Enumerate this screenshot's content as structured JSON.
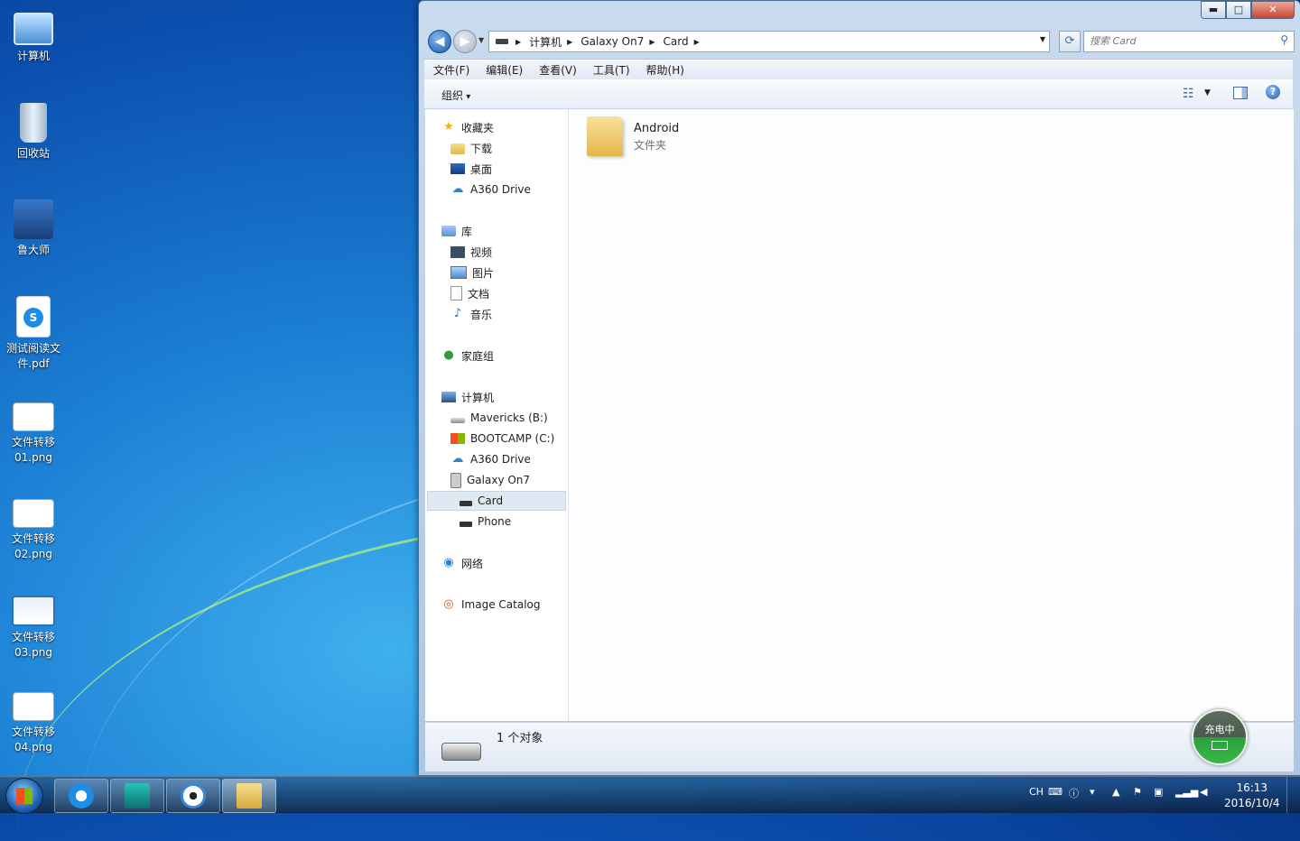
{
  "desktop": {
    "icons": [
      {
        "label": "计算机"
      },
      {
        "label": "回收站"
      },
      {
        "label": "鲁大师"
      },
      {
        "label": "测试阅读文件.pdf"
      },
      {
        "label": "文件转移01.png"
      },
      {
        "label": "文件转移02.png"
      },
      {
        "label": "文件转移03.png"
      },
      {
        "label": "文件转移04.png"
      }
    ]
  },
  "window": {
    "caption": {
      "minimize": "▬",
      "maximize": "□",
      "close": "✕"
    },
    "address": {
      "crumbs": [
        "计算机",
        "Galaxy On7",
        "Card"
      ]
    },
    "search": {
      "placeholder": "搜索 Card"
    },
    "menu": [
      "文件(F)",
      "编辑(E)",
      "查看(V)",
      "工具(T)",
      "帮助(H)"
    ],
    "toolbar": {
      "organize": "组织",
      "help": "?"
    },
    "nav": {
      "favorites": {
        "label": "收藏夹",
        "items": [
          "下载",
          "桌面",
          "A360 Drive"
        ]
      },
      "libraries": {
        "label": "库",
        "items": [
          "视频",
          "图片",
          "文档",
          "音乐"
        ]
      },
      "homegroup": {
        "label": "家庭组"
      },
      "computer": {
        "label": "计算机",
        "items": [
          "Mavericks (B:)",
          "BOOTCAMP (C:)",
          "A360 Drive",
          "Galaxy On7"
        ],
        "device_items": [
          "Card",
          "Phone"
        ]
      },
      "network": {
        "label": "网络"
      },
      "image_catalog": {
        "label": "Image Catalog"
      }
    },
    "content": {
      "items": [
        {
          "name": "Android",
          "type": "文件夹"
        }
      ]
    },
    "details": {
      "count": "1 个对象"
    }
  },
  "charging": {
    "label": "充电中"
  },
  "taskbar": {
    "tray": {
      "lang": "CH"
    },
    "clock": {
      "time": "16:13",
      "date": "2016/10/4"
    }
  }
}
